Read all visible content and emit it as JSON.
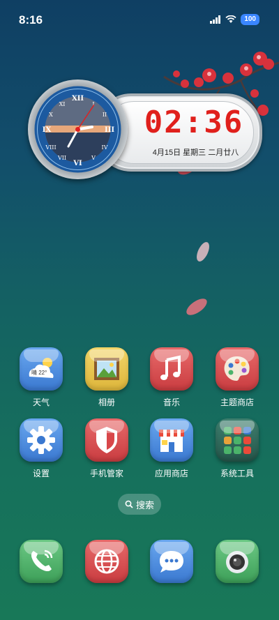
{
  "status_bar": {
    "time": "8:16",
    "battery": "100",
    "icons": [
      "signal-icon",
      "wifi-icon",
      "battery-icon"
    ]
  },
  "clock_widget": {
    "digital_time": "02:36",
    "date_text": "4月15日 星期三 二月廿八",
    "analog_numerals": [
      "XII",
      "III",
      "VI",
      "IX"
    ]
  },
  "apps_row1": [
    {
      "label": "天气",
      "icon": "weather-icon",
      "color": "#4a8fe0",
      "temp": "晴 22°"
    },
    {
      "label": "相册",
      "icon": "gallery-icon",
      "color": "#e8c24a"
    },
    {
      "label": "音乐",
      "icon": "music-icon",
      "color": "#d9474a"
    },
    {
      "label": "主题商店",
      "icon": "palette-icon",
      "color": "#d9474a"
    }
  ],
  "apps_row2": [
    {
      "label": "设置",
      "icon": "settings-gear-icon",
      "color": "#4a8fe0"
    },
    {
      "label": "手机管家",
      "icon": "shield-icon",
      "color": "#d9474a"
    },
    {
      "label": "应用商店",
      "icon": "store-icon",
      "color": "#4a8fe0"
    },
    {
      "label": "系统工具",
      "icon": "folder-icon",
      "color": "#2e6a5a"
    }
  ],
  "search": {
    "label": "搜索"
  },
  "dock": [
    {
      "icon": "phone-icon",
      "color": "#4bb36a"
    },
    {
      "icon": "browser-globe-icon",
      "color": "#d9474a"
    },
    {
      "icon": "messages-icon",
      "color": "#4a8fe0"
    },
    {
      "icon": "camera-icon",
      "color": "#4bb36a"
    }
  ]
}
